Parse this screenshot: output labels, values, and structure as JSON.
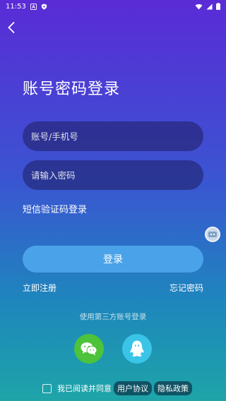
{
  "status_bar": {
    "time": "11:53"
  },
  "page": {
    "title": "账号密码登录"
  },
  "form": {
    "account_placeholder": "账号/手机号",
    "password_placeholder": "请输入密码",
    "sms_login_link": "短信验证码登录",
    "login_button": "登录",
    "register_link": "立即注册",
    "forgot_password_link": "忘记密码"
  },
  "third_party": {
    "label": "使用第三方账号登录",
    "icons": [
      "wechat-icon",
      "qq-icon"
    ]
  },
  "agreement": {
    "prefix": "我已阅读并同意",
    "user_agreement": "用户协议",
    "privacy_policy": "隐私政策"
  },
  "colors": {
    "gradient_top": "#5a2bd6",
    "gradient_bottom": "#1ea5a8",
    "login_button": "#4aa3e8",
    "wechat": "#4cc33a",
    "qq": "#39c4e8"
  }
}
